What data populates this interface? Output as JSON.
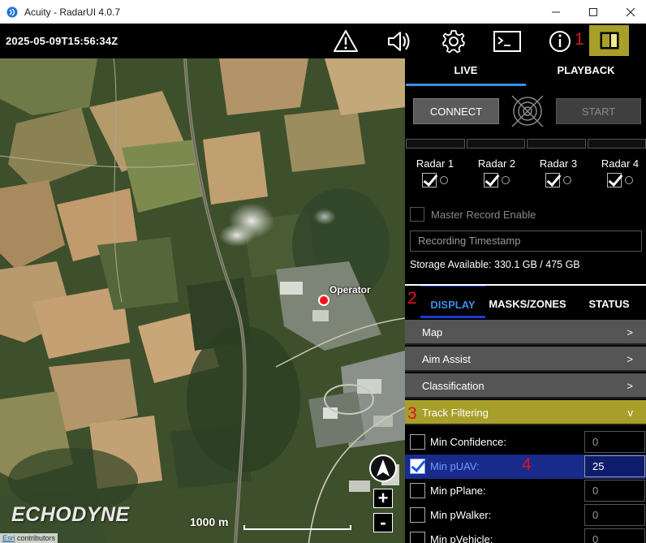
{
  "window": {
    "title": "Acuity - RadarUI 4.0.7",
    "minimize_glyph": "—",
    "maximize_glyph": "☐",
    "close_glyph": "✕"
  },
  "toolbar": {
    "timestamp": "2025-05-09T15:56:34Z",
    "icons": [
      "warning-icon",
      "speaker-icon",
      "gear-icon",
      "terminal-icon",
      "info-icon",
      "panel-toggle-icon"
    ],
    "marker_1": "1",
    "panel_toggle_color": "#a89f2a"
  },
  "map": {
    "operator_label": "Operator",
    "logo": "ECHODYNE",
    "scale_label": "1000 m",
    "attribution_esri": "Esri",
    "attribution_rest": " contributors",
    "zoom_in": "+",
    "zoom_out": "-"
  },
  "panel": {
    "tabs": {
      "live": "LIVE",
      "playback": "PLAYBACK"
    },
    "connect_label": "CONNECT",
    "start_label": "START",
    "radars": [
      {
        "label": "Radar 1",
        "checked": true
      },
      {
        "label": "Radar 2",
        "checked": true
      },
      {
        "label": "Radar 3",
        "checked": true
      },
      {
        "label": "Radar 4",
        "checked": true
      }
    ],
    "master_record_label": "Master Record Enable",
    "recording_timestamp_placeholder": "Recording Timestamp",
    "storage_text": "Storage Available: 330.1 GB / 475 GB",
    "section_tabs": {
      "marker": "2",
      "display": "DISPLAY",
      "masks": "MASKS/ZONES",
      "status": "STATUS"
    },
    "accordions": [
      {
        "label": "Map",
        "chevron": ">"
      },
      {
        "label": "Aim Assist",
        "chevron": ">"
      },
      {
        "label": "Classification",
        "chevron": ">"
      }
    ],
    "track_filtering": {
      "marker": "3",
      "label": "Track Filtering",
      "chevron": "v"
    },
    "filters": [
      {
        "label": "Min Confidence:",
        "value": "0",
        "checked": false
      },
      {
        "label": "Min pUAV:",
        "value": "25",
        "checked": true,
        "marker": "4"
      },
      {
        "label": "Min pPlane:",
        "value": "0",
        "checked": false
      },
      {
        "label": "Min pWalker:",
        "value": "0",
        "checked": false
      },
      {
        "label": "Min pVehicle:",
        "value": "0",
        "checked": false
      }
    ],
    "colors": {
      "accent_blue": "#3a8ee6",
      "marker_red": "#e0141e",
      "selected_row": "#1a2a8a"
    }
  }
}
